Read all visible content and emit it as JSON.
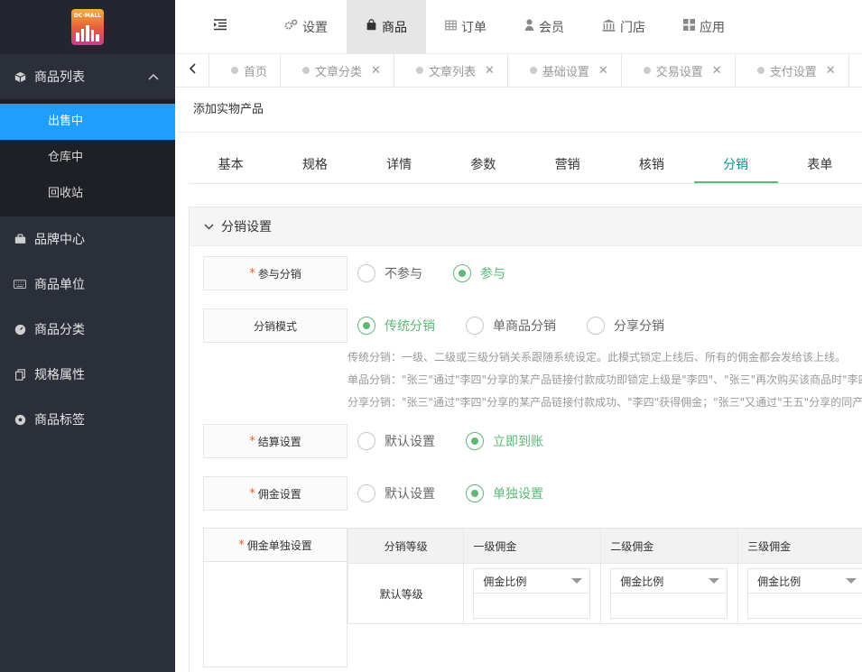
{
  "logo": {
    "text": "DC-MALL"
  },
  "sidebar": {
    "groups": [
      {
        "label": "商品列表",
        "icon": "cube-icon",
        "expanded": true,
        "children": [
          {
            "label": "出售中",
            "active": true
          },
          {
            "label": "仓库中",
            "active": false
          },
          {
            "label": "回收站",
            "active": false
          }
        ]
      },
      {
        "label": "品牌中心",
        "icon": "briefcase-icon"
      },
      {
        "label": "商品单位",
        "icon": "keyboard-icon"
      },
      {
        "label": "商品分类",
        "icon": "gauge-icon"
      },
      {
        "label": "规格属性",
        "icon": "copy-icon"
      },
      {
        "label": "商品标签",
        "icon": "soccer-ball-icon"
      }
    ]
  },
  "topnav": {
    "items": [
      {
        "label": "设置",
        "icon": "gears-icon",
        "active": false
      },
      {
        "label": "商品",
        "icon": "shopping-bag-icon",
        "active": true
      },
      {
        "label": "订单",
        "icon": "table-icon",
        "active": false
      },
      {
        "label": "会员",
        "icon": "user-icon",
        "active": false
      },
      {
        "label": "门店",
        "icon": "bank-icon",
        "active": false
      },
      {
        "label": "应用",
        "icon": "apps-grid-icon",
        "active": false
      }
    ]
  },
  "page_tabs": [
    {
      "label": "首页",
      "closable": false
    },
    {
      "label": "文章分类",
      "closable": true
    },
    {
      "label": "文章列表",
      "closable": true
    },
    {
      "label": "基础设置",
      "closable": true
    },
    {
      "label": "交易设置",
      "closable": true
    },
    {
      "label": "支付设置",
      "closable": true
    }
  ],
  "page": {
    "title": "添加实物产品",
    "form_tabs": [
      "基本",
      "规格",
      "详情",
      "参数",
      "营销",
      "核销",
      "分销",
      "表单"
    ],
    "active_form_tab": "分销"
  },
  "section": {
    "title": "分销设置",
    "participate": {
      "label": "参与分销",
      "options": [
        "不参与",
        "参与"
      ],
      "selected": "参与"
    },
    "mode": {
      "label": "分销模式",
      "options": [
        "传统分销",
        "单商品分销",
        "分享分销"
      ],
      "selected": "传统分销",
      "help": [
        "传统分销：一级、二级或三级分销关系跟随系统设定。此模式锁定上线后、所有的佣金都会发给该上线。",
        "单品分销：\"张三\"通过\"李四\"分享的某产品链接付款成功即锁定上级是\"李四\"、\"张三\"再次购买该商品时\"李四\"会",
        "分享分销：\"张三\"通过\"李四\"分享的某产品链接付款成功、\"李四\"获得佣金；\"张三\"又通过\"王五\"分享的同产品链"
      ]
    },
    "settlement": {
      "label": "结算设置",
      "options": [
        "默认设置",
        "立即到账"
      ],
      "selected": "立即到账"
    },
    "commission": {
      "label": "佣金设置",
      "options": [
        "默认设置",
        "单独设置"
      ],
      "selected": "单独设置"
    },
    "commission_custom": {
      "label": "佣金单独设置",
      "columns": [
        "分销等级",
        "一级佣金",
        "二级佣金",
        "三级佣金"
      ],
      "rows": [
        {
          "level": "默认等级",
          "cells": [
            {
              "select": "佣金比例",
              "value": ""
            },
            {
              "select": "佣金比例",
              "value": ""
            },
            {
              "select": "佣金比例",
              "value": ""
            }
          ]
        }
      ]
    }
  }
}
